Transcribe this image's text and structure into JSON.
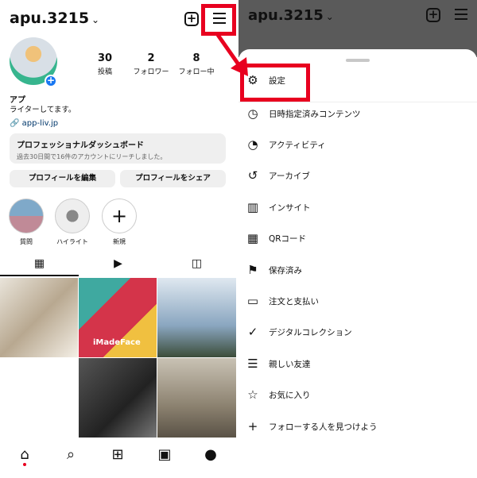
{
  "profile": {
    "username": "apu.3215",
    "name": "アプ",
    "bio": "ライターしてます。",
    "link": "app-liv.jp",
    "stats": [
      {
        "value": "30",
        "label": "投稿"
      },
      {
        "value": "2",
        "label": "フォロワー"
      },
      {
        "value": "8",
        "label": "フォロー中"
      }
    ],
    "dashboard": {
      "title": "プロフェッショナルダッシュボード",
      "subtitle": "過去30日間で16件のアカウントにリーチしました。"
    },
    "edit_button": "プロフィールを編集",
    "share_button": "プロフィールをシェア",
    "highlights": [
      {
        "label": "質問"
      },
      {
        "label": "ハイライト"
      },
      {
        "label": "新規"
      }
    ],
    "grid_text": "iMadeFace"
  },
  "menu": {
    "items": [
      {
        "label": "設定",
        "icon": "settings-icon"
      },
      {
        "label": "日時指定済みコンテンツ",
        "icon": "clock-icon"
      },
      {
        "label": "アクティビティ",
        "icon": "activity-icon"
      },
      {
        "label": "アーカイブ",
        "icon": "archive-icon"
      },
      {
        "label": "インサイト",
        "icon": "insights-icon"
      },
      {
        "label": "QRコード",
        "icon": "qr-icon"
      },
      {
        "label": "保存済み",
        "icon": "bookmark-icon"
      },
      {
        "label": "注文と支払い",
        "icon": "card-icon"
      },
      {
        "label": "デジタルコレクション",
        "icon": "verified-icon"
      },
      {
        "label": "親しい友達",
        "icon": "list-icon"
      },
      {
        "label": "お気に入り",
        "icon": "star-icon"
      },
      {
        "label": "フォローする人を見つけよう",
        "icon": "add-person-icon"
      }
    ]
  },
  "colors": {
    "highlight": "#e8001f",
    "link": "#00376b",
    "accent": "#1877f2"
  }
}
